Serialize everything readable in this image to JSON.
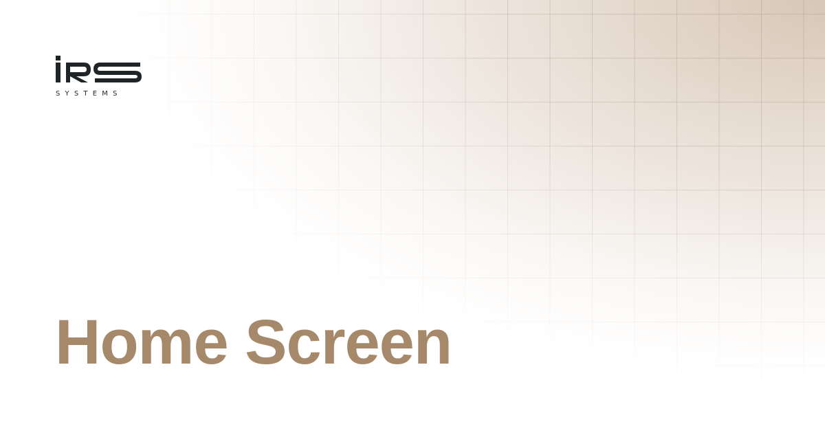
{
  "brand": {
    "logo_text": "iRS",
    "logo_subtext": "SYSTEMS",
    "logo_color": "#1f2426"
  },
  "page": {
    "title": "Home Screen",
    "title_color": "#a6896a"
  },
  "colors": {
    "background": "#ffffff",
    "gradient_warm": "#d7c7b6"
  }
}
